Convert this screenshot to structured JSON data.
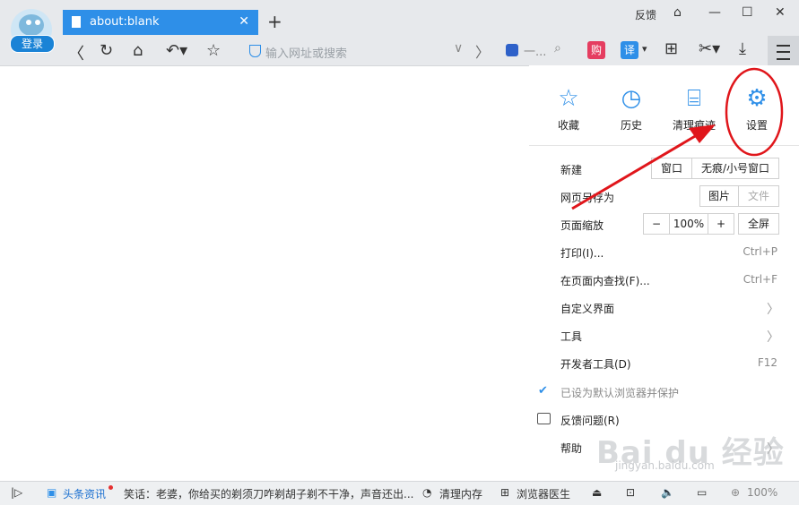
{
  "account": {
    "login_label": "登录"
  },
  "tab": {
    "title": "about:blank",
    "close": "✕",
    "new_tab": "+"
  },
  "window": {
    "feedback": "反馈",
    "skin": "⌂",
    "minimize": "—",
    "maximize": "☐",
    "close": "✕"
  },
  "nav": {
    "back": "〈",
    "refresh": "↻",
    "home": "⌂",
    "undo": "↶▾",
    "favorite": "☆"
  },
  "address": {
    "placeholder": "输入网址或搜索",
    "dropdown": "∨",
    "forward": "〉"
  },
  "search": {
    "text": "一...",
    "icon": "⌕"
  },
  "toolbar": {
    "shopping": "购",
    "translate": "译",
    "translate_dd": "▾",
    "apps": "⊞",
    "screenshot": "✂▾",
    "download": "⤓"
  },
  "menu": {
    "quick": [
      {
        "label": "收藏",
        "icon": "star-icon",
        "glyph": "☆"
      },
      {
        "label": "历史",
        "icon": "clock-icon",
        "glyph": "◷"
      },
      {
        "label": "清理痕迹",
        "icon": "broom-icon",
        "glyph": "⌸"
      },
      {
        "label": "设置",
        "icon": "gear-icon",
        "glyph": "⚙"
      }
    ],
    "new": {
      "label": "新建",
      "window": "窗口",
      "incognito": "无痕/小号窗口"
    },
    "saveas": {
      "label": "网页另存为",
      "image": "图片",
      "file": "文件"
    },
    "zoom": {
      "label": "页面缩放",
      "minus": "−",
      "value": "100%",
      "plus": "+",
      "fullscreen": "全屏"
    },
    "print": {
      "label": "打印(I)...",
      "shortcut": "Ctrl+P"
    },
    "find": {
      "label": "在页面内查找(F)...",
      "shortcut": "Ctrl+F"
    },
    "customize": {
      "label": "自定义界面"
    },
    "tools": {
      "label": "工具"
    },
    "devtools": {
      "label": "开发者工具(D)",
      "shortcut": "F12"
    },
    "default_browser": {
      "label": "已设为默认浏览器并保护"
    },
    "feedback": {
      "label": "反馈问题(R)"
    },
    "help": {
      "label": "帮助"
    },
    "chevron": "〉"
  },
  "statusbar": {
    "toggle": "|▷",
    "news_label": "头条资讯",
    "headline": "笑话：老婆，你给买的剃须刀咋剃胡子剃不干净，声音还出...",
    "clean_memory": "清理内存",
    "doctor": "浏览器医生",
    "zoom": "100%"
  },
  "watermark": {
    "text": "Bai du 经验",
    "url": "jingyan.baidu.com"
  },
  "colors": {
    "accent": "#2e8fe8",
    "annotation": "#e0161b",
    "shopping": "#e53d60"
  }
}
